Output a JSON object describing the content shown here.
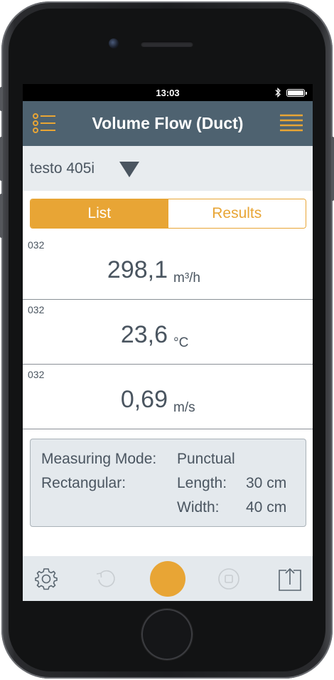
{
  "status_bar": {
    "time": "13:03"
  },
  "nav": {
    "title": "Volume Flow (Duct)",
    "left_icon": "list-icon",
    "right_icon": "menu-icon"
  },
  "device": {
    "name": "testo 405i"
  },
  "tabs": [
    {
      "label": "List",
      "active": true
    },
    {
      "label": "Results",
      "active": false
    }
  ],
  "readings": [
    {
      "channel": "032",
      "value": "298,1",
      "unit": "m³/h"
    },
    {
      "channel": "032",
      "value": "23,6",
      "unit": "°C"
    },
    {
      "channel": "032",
      "value": "0,69",
      "unit": "m/s"
    }
  ],
  "info": {
    "mode_label": "Measuring Mode:",
    "mode_value": "Punctual",
    "shape_label": "Rectangular:",
    "length_label": "Length:",
    "length_value": "30 cm",
    "width_label": "Width:",
    "width_value": "40 cm"
  },
  "colors": {
    "accent": "#e8a535",
    "navbar": "#4e6270",
    "text": "#4a5560",
    "panel": "#e4e9ed"
  }
}
